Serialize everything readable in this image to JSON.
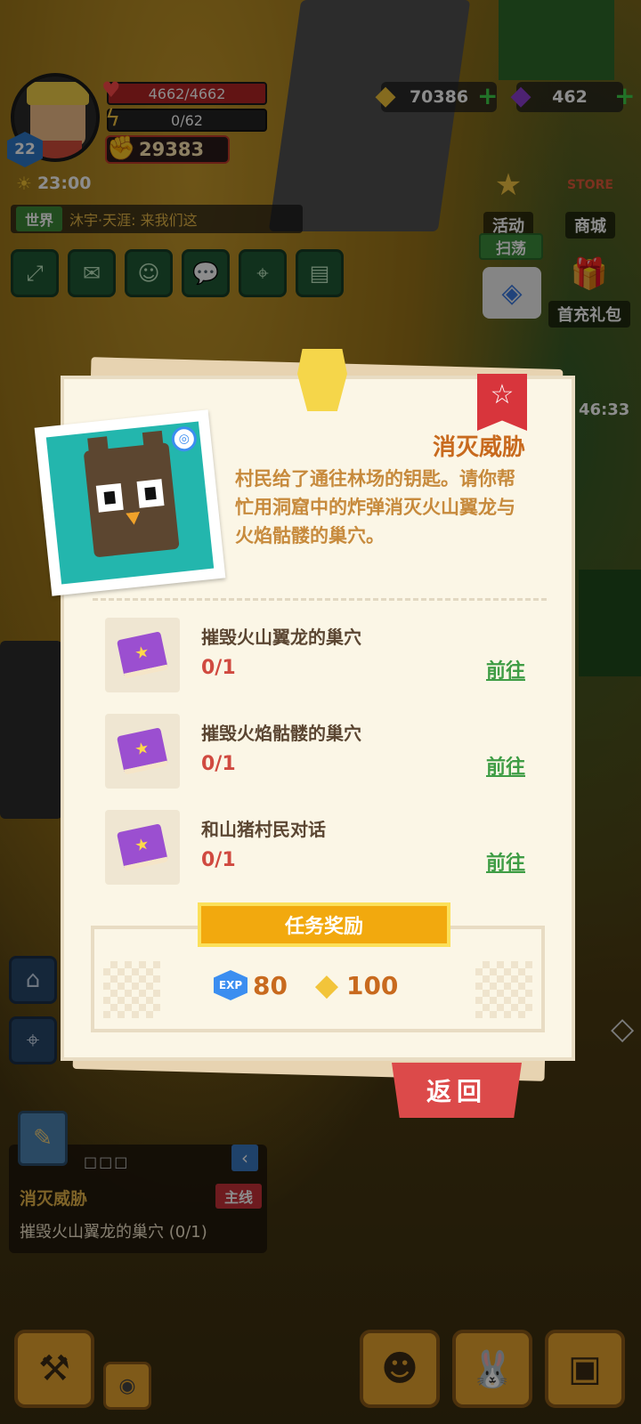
{
  "player": {
    "level": "22",
    "hp": "4662/4662",
    "energy": "0/62",
    "power": "29383",
    "time": "23:00"
  },
  "chat": {
    "channel": "世界",
    "message": "沐宇·天涯: 来我们这"
  },
  "currency": {
    "gold": "70386",
    "gems": "462"
  },
  "side_buttons": {
    "activity": "活动",
    "store": "商城",
    "store_sign": "STORE",
    "sweep": "扫荡",
    "first_pay": "首充礼包",
    "timer": "46:33"
  },
  "quest": {
    "title": "消灭威胁",
    "description": "村民给了通往林场的钥匙。请你帮忙用洞窟中的炸弹消灭火山翼龙与火焰骷髅的巢穴。",
    "objectives": [
      {
        "name": "摧毁火山翼龙的巢穴",
        "progress": "0/1",
        "action": "前往"
      },
      {
        "name": "摧毁火焰骷髅的巢穴",
        "progress": "0/1",
        "action": "前往"
      },
      {
        "name": "和山猪村民对话",
        "progress": "0/1",
        "action": "前往"
      }
    ],
    "reward_header": "任务奖励",
    "rewards": {
      "exp_label": "EXP",
      "exp": "80",
      "gold": "100"
    },
    "back_label": "返回"
  },
  "tracker": {
    "dots": "□□□",
    "title": "消灭威胁",
    "tag": "主线",
    "desc": "摧毁火山翼龙的巢穴   (0/1)"
  },
  "colors": {
    "accent": "#c86a1e",
    "go": "#3f9d45",
    "back": "#dc4a4a",
    "reward_header": "#f2a90e"
  }
}
